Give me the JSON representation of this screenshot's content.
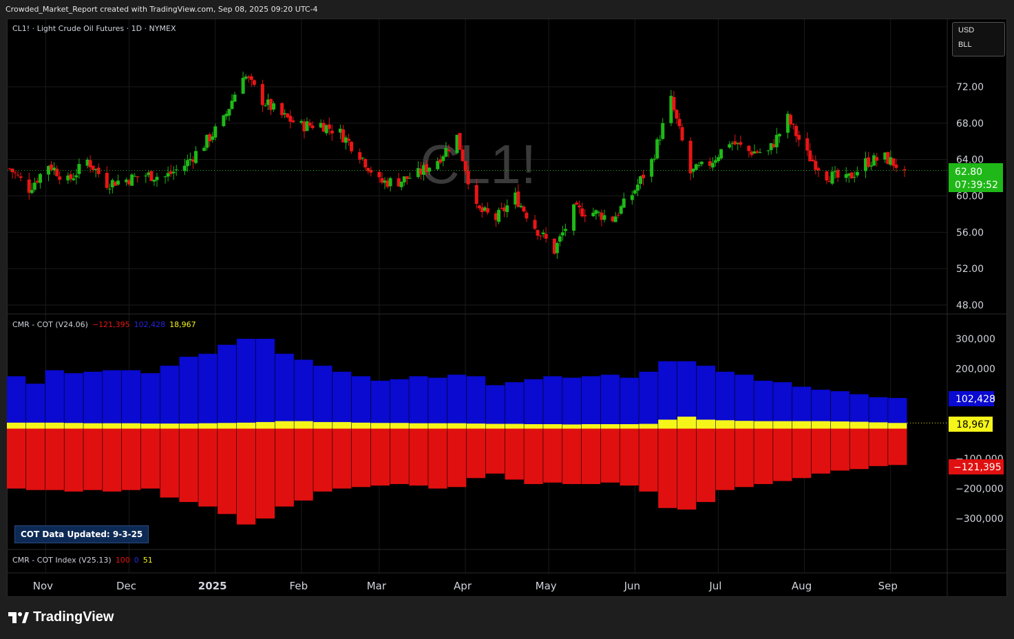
{
  "header": {
    "text": "Crowded_Market_Report created with TradingView.com, Sep 08, 2025 09:20 UTC-4"
  },
  "main_legend": {
    "symbol": "CL1! · Light Crude Oil Futures · 1D · NYMEX"
  },
  "watermark": "CL1!",
  "currency": {
    "line1": "USD",
    "line2": "BLL"
  },
  "price_axis": {
    "ticks": [
      "72.00",
      "68.00",
      "64.00",
      "60.00",
      "56.00",
      "52.00",
      "48.00"
    ]
  },
  "last_price": {
    "value": "62.80",
    "countdown": "07:39:52",
    "color": "#1fb818"
  },
  "cot_legend": {
    "name": "CMR - COT (V24.06)",
    "v_red": "−121,395",
    "v_blue": "102,428",
    "v_yellow": "18,967"
  },
  "cot_axis": {
    "ticks": [
      "300,000",
      "200,000",
      "100,000",
      "−100,000",
      "−200,000",
      "−300,000"
    ]
  },
  "cot_tags": {
    "blue": "102,428",
    "yellow": "18,967",
    "red": "−121,395"
  },
  "cot_updated": "COT Data Updated:  9-3-25",
  "index_legend": {
    "name": "CMR - COT Index (V25.13)",
    "v_red": "100",
    "v_blue": "0",
    "v_yellow": "51"
  },
  "time_axis": {
    "labels": [
      "Nov",
      "Dec",
      "2025",
      "Feb",
      "Mar",
      "Apr",
      "May",
      "Jun",
      "Jul",
      "Aug",
      "Sep"
    ]
  },
  "footer": {
    "brand": "TradingView"
  },
  "colors": {
    "up": "#1fb818",
    "down": "#e81515",
    "blue": "#0a0ad0",
    "yellow": "#f5f51a",
    "red": "#e01010"
  },
  "chart_data": [
    {
      "type": "candlestick",
      "title": "CL1! · Light Crude Oil Futures · 1D · NYMEX",
      "ylim": [
        47,
        76
      ],
      "close_anchors": [
        {
          "date": "2024-10-21",
          "close": 63.0
        },
        {
          "date": "2024-10-28",
          "close": 60.8
        },
        {
          "date": "2024-11-04",
          "close": 63.5
        },
        {
          "date": "2024-11-11",
          "close": 61.6
        },
        {
          "date": "2024-11-18",
          "close": 63.9
        },
        {
          "date": "2024-11-25",
          "close": 61.4
        },
        {
          "date": "2024-12-02",
          "close": 61.8
        },
        {
          "date": "2024-12-09",
          "close": 62.3
        },
        {
          "date": "2024-12-16",
          "close": 62.1
        },
        {
          "date": "2024-12-23",
          "close": 63.4
        },
        {
          "date": "2024-12-30",
          "close": 65.7
        },
        {
          "date": "2025-01-06",
          "close": 68.3
        },
        {
          "date": "2025-01-13",
          "close": 73.5
        },
        {
          "date": "2025-01-20",
          "close": 70.5
        },
        {
          "date": "2025-01-27",
          "close": 68.8
        },
        {
          "date": "2025-02-03",
          "close": 67.7
        },
        {
          "date": "2025-02-10",
          "close": 67.9
        },
        {
          "date": "2025-02-17",
          "close": 66.9
        },
        {
          "date": "2025-02-24",
          "close": 64.6
        },
        {
          "date": "2025-03-03",
          "close": 61.5
        },
        {
          "date": "2025-03-10",
          "close": 61.6
        },
        {
          "date": "2025-03-17",
          "close": 62.4
        },
        {
          "date": "2025-03-24",
          "close": 64.0
        },
        {
          "date": "2025-03-31",
          "close": 66.5
        },
        {
          "date": "2025-04-07",
          "close": 58.5
        },
        {
          "date": "2025-04-14",
          "close": 57.5
        },
        {
          "date": "2025-04-21",
          "close": 59.9
        },
        {
          "date": "2025-04-28",
          "close": 56.6
        },
        {
          "date": "2025-05-05",
          "close": 54.0
        },
        {
          "date": "2025-05-12",
          "close": 58.4
        },
        {
          "date": "2025-05-19",
          "close": 58.2
        },
        {
          "date": "2025-05-26",
          "close": 57.5
        },
        {
          "date": "2025-06-02",
          "close": 60.2
        },
        {
          "date": "2025-06-09",
          "close": 63.8
        },
        {
          "date": "2025-06-16",
          "close": 70.5
        },
        {
          "date": "2025-06-23",
          "close": 62.5
        },
        {
          "date": "2025-06-30",
          "close": 63.6
        },
        {
          "date": "2025-07-07",
          "close": 66.0
        },
        {
          "date": "2025-07-14",
          "close": 64.9
        },
        {
          "date": "2025-07-21",
          "close": 64.8
        },
        {
          "date": "2025-07-28",
          "close": 68.5
        },
        {
          "date": "2025-08-04",
          "close": 64.5
        },
        {
          "date": "2025-08-11",
          "close": 62.3
        },
        {
          "date": "2025-08-18",
          "close": 61.7
        },
        {
          "date": "2025-08-25",
          "close": 63.7
        },
        {
          "date": "2025-09-01",
          "close": 64.2
        },
        {
          "date": "2025-09-08",
          "close": 62.8
        }
      ],
      "last_close": 62.8
    },
    {
      "type": "bar",
      "title": "CMR - COT (V24.06)",
      "ylim": [
        -400000,
        330000
      ],
      "series": [
        {
          "name": "blue",
          "color": "#0a0ad0",
          "values": [
            175000,
            150000,
            195000,
            185000,
            190000,
            195000,
            195000,
            185000,
            210000,
            240000,
            250000,
            280000,
            300000,
            300000,
            250000,
            230000,
            210000,
            190000,
            175000,
            160000,
            165000,
            175000,
            170000,
            180000,
            175000,
            145000,
            155000,
            165000,
            175000,
            170000,
            175000,
            180000,
            170000,
            190000,
            225000,
            225000,
            210000,
            190000,
            180000,
            160000,
            155000,
            140000,
            130000,
            125000,
            115000,
            105000,
            102428
          ]
        },
        {
          "name": "yellow",
          "color": "#f5f51a",
          "values": [
            20000,
            20000,
            20000,
            19000,
            18000,
            18000,
            18000,
            17000,
            17000,
            17000,
            18000,
            19000,
            20000,
            22000,
            25000,
            25000,
            22000,
            22000,
            20000,
            19000,
            19000,
            18000,
            18000,
            18000,
            17000,
            16000,
            16000,
            15000,
            15000,
            14000,
            15000,
            15000,
            15000,
            16000,
            30000,
            40000,
            30000,
            28000,
            26000,
            25000,
            25000,
            25000,
            25000,
            24000,
            23000,
            21000,
            18967
          ]
        },
        {
          "name": "red",
          "color": "#e01010",
          "values": [
            -200000,
            -205000,
            -205000,
            -210000,
            -205000,
            -210000,
            -205000,
            -200000,
            -230000,
            -245000,
            -260000,
            -285000,
            -320000,
            -300000,
            -260000,
            -240000,
            -210000,
            -200000,
            -195000,
            -190000,
            -185000,
            -190000,
            -200000,
            -195000,
            -165000,
            -150000,
            -170000,
            -185000,
            -180000,
            -185000,
            -185000,
            -180000,
            -190000,
            -210000,
            -265000,
            -270000,
            -245000,
            -205000,
            -195000,
            -185000,
            -175000,
            -165000,
            -150000,
            -140000,
            -135000,
            -125000,
            -121395
          ]
        }
      ]
    }
  ]
}
